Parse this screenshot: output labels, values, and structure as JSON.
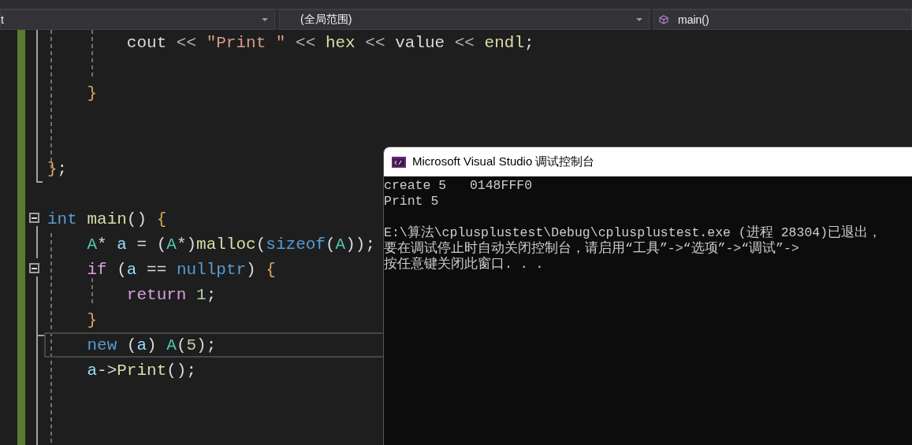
{
  "navigation_bar": {
    "dropdowns": [
      {
        "label": "t",
        "kind": "plain"
      },
      {
        "label": "(全局范围)",
        "kind": "plain"
      },
      {
        "label": "main()",
        "kind": "member"
      }
    ]
  },
  "editor": {
    "lines": [
      {
        "current": false,
        "tokens": [
          {
            "text": "        cout ",
            "kind": "plain"
          },
          {
            "text": "<< ",
            "kind": "operator"
          },
          {
            "text": "\"Print \"",
            "kind": "string"
          },
          {
            "text": " << ",
            "kind": "operator"
          },
          {
            "text": "hex",
            "kind": "function"
          },
          {
            "text": " << ",
            "kind": "operator"
          },
          {
            "text": "value",
            "kind": "plain"
          },
          {
            "text": " << ",
            "kind": "operator"
          },
          {
            "text": "endl",
            "kind": "function"
          },
          {
            "text": ";",
            "kind": "plain"
          }
        ]
      },
      {
        "current": false
      },
      {
        "current": false,
        "tokens": [
          {
            "text": "    }",
            "kind": "brace"
          }
        ]
      },
      {
        "current": false
      },
      {
        "current": false
      },
      {
        "current": false,
        "tokens": [
          {
            "text": "}",
            "kind": "brace"
          },
          {
            "text": ";",
            "kind": "plain"
          }
        ]
      },
      {
        "current": false
      },
      {
        "current": false,
        "fold_expanded": true,
        "tokens": [
          {
            "text": "int ",
            "kind": "keyword"
          },
          {
            "text": "main",
            "kind": "function"
          },
          {
            "text": "() ",
            "kind": "plain"
          },
          {
            "text": "{",
            "kind": "brace"
          }
        ]
      },
      {
        "current": false,
        "tokens": [
          {
            "text": "    A",
            "kind": "type"
          },
          {
            "text": "* ",
            "kind": "plain"
          },
          {
            "text": "a",
            "kind": "variable"
          },
          {
            "text": " = (",
            "kind": "plain"
          },
          {
            "text": "A",
            "kind": "type"
          },
          {
            "text": "*)",
            "kind": "plain"
          },
          {
            "text": "malloc",
            "kind": "function"
          },
          {
            "text": "(",
            "kind": "plain"
          },
          {
            "text": "sizeof",
            "kind": "keyword"
          },
          {
            "text": "(",
            "kind": "plain"
          },
          {
            "text": "A",
            "kind": "type"
          },
          {
            "text": "));",
            "kind": "plain"
          }
        ]
      },
      {
        "current": false,
        "fold_expanded": true,
        "tokens": [
          {
            "text": "    if",
            "kind": "control"
          },
          {
            "text": " (",
            "kind": "plain"
          },
          {
            "text": "a",
            "kind": "variable"
          },
          {
            "text": " == ",
            "kind": "plain"
          },
          {
            "text": "nullptr",
            "kind": "keyword"
          },
          {
            "text": ") ",
            "kind": "plain"
          },
          {
            "text": "{",
            "kind": "brace"
          }
        ]
      },
      {
        "current": false,
        "tokens": [
          {
            "text": "        return ",
            "kind": "control"
          },
          {
            "text": "1",
            "kind": "number"
          },
          {
            "text": ";",
            "kind": "plain"
          }
        ]
      },
      {
        "current": false,
        "tokens": [
          {
            "text": "    }",
            "kind": "brace"
          }
        ]
      },
      {
        "current": true,
        "tokens": [
          {
            "text": "    new",
            "kind": "keyword"
          },
          {
            "text": " (",
            "kind": "plain"
          },
          {
            "text": "a",
            "kind": "variable"
          },
          {
            "text": ") ",
            "kind": "plain"
          },
          {
            "text": "A",
            "kind": "type"
          },
          {
            "text": "(",
            "kind": "plain"
          },
          {
            "text": "5",
            "kind": "number"
          },
          {
            "text": ");",
            "kind": "plain"
          }
        ]
      },
      {
        "current": false,
        "tokens": [
          {
            "text": "    a",
            "kind": "variable"
          },
          {
            "text": "->",
            "kind": "plain"
          },
          {
            "text": "Print",
            "kind": "function"
          },
          {
            "text": "();",
            "kind": "plain"
          }
        ]
      }
    ]
  },
  "console_window": {
    "title": "Microsoft Visual Studio 调试控制台",
    "paragraphs": [
      {
        "lines": [
          "create 5   0148FFF0",
          "Print 5"
        ]
      },
      {
        "lines": [
          "E:\\算法\\cplusplustest\\Debug\\cplusplustest.exe (进程 28304)已退出，",
          "要在调试停止时自动关闭控制台，请启用“工具”->“选项”->“调试”->",
          "按任意键关闭此窗口. . ."
        ]
      }
    ]
  }
}
